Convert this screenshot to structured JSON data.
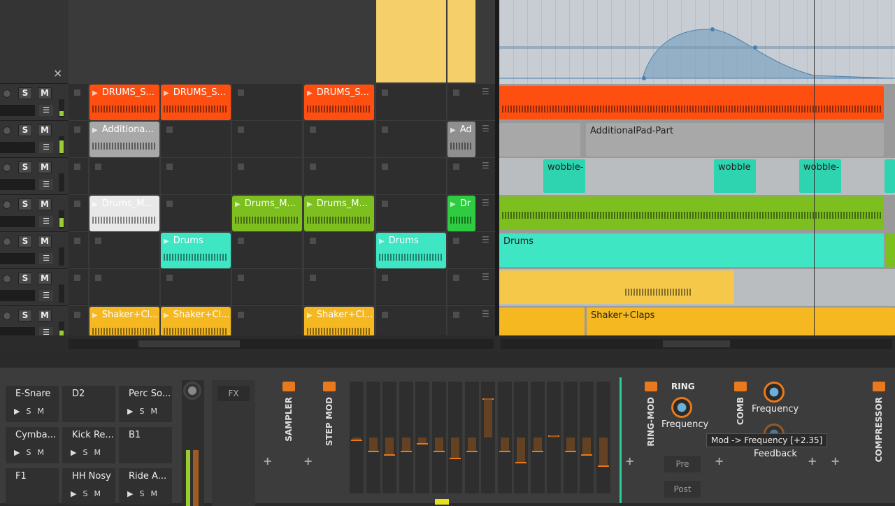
{
  "tracks": [
    {
      "s": "S",
      "m": "M",
      "meter": 0.3
    },
    {
      "s": "S",
      "m": "M",
      "meter": 0.8
    },
    {
      "s": "S",
      "m": "M",
      "meter": 0
    },
    {
      "s": "S",
      "m": "M",
      "meter": 0.6
    },
    {
      "s": "S",
      "m": "M",
      "meter": 0
    },
    {
      "s": "S",
      "m": "M",
      "meter": 0
    },
    {
      "s": "S",
      "m": "M",
      "meter": 0.5
    }
  ],
  "launcher_clips": [
    {
      "label": "DRUMS_S...",
      "color": "#ff4f10"
    },
    {
      "label": "Additiona...",
      "color": "#a8a8a8"
    },
    {
      "label": "Drums_M...",
      "color": "#e8e8e8"
    },
    {
      "label": "Drums",
      "color": "#3ee6c4"
    },
    {
      "label": "Shaker+Cl...",
      "color": "#f5b820"
    },
    {
      "label": "Drums_M...",
      "color": "#7cbf1e"
    },
    {
      "label": "Ad",
      "color": "#8f8f8f"
    },
    {
      "label": "Dr",
      "color": "#2ecc40"
    }
  ],
  "arranger_clips": {
    "additional_pad": "AdditionalPad-Part",
    "wobble": "wobble",
    "wobble_trunc": "wobble-",
    "drums": "Drums",
    "shaker": "Shaker+Claps"
  },
  "drum_pads": [
    {
      "name": "E-Snare",
      "ctl": "▶SM"
    },
    {
      "name": "D2",
      "ctl": ""
    },
    {
      "name": "Perc So...",
      "ctl": "▶SM"
    },
    {
      "name": "Cymba...",
      "ctl": "▶SM"
    },
    {
      "name": "Kick Re...",
      "ctl": "▶SM"
    },
    {
      "name": "B1",
      "ctl": ""
    },
    {
      "name": "F1",
      "ctl": ""
    },
    {
      "name": "HH Nosy",
      "ctl": "▶SM"
    },
    {
      "name": "Ride A...",
      "ctl": "▶SM"
    }
  ],
  "close_x": "×",
  "devices": {
    "fx": "FX",
    "sampler": "SAMPLER",
    "step_mod": "STEP MOD",
    "ring_mod": "RING-MOD",
    "ring": "RING",
    "frequency": "Frequency",
    "comb": "COMB",
    "comb_frequency": "Frequency",
    "feedback": "Feedback",
    "compressor": "COMPRESSOR",
    "pre": "Pre",
    "post": "Post",
    "tooltip": "Mod -> Frequency [+2.35]"
  },
  "step_values": [
    0.48,
    0.38,
    0.35,
    0.38,
    0.45,
    0.38,
    0.32,
    0.38,
    0.85,
    0.38,
    0.28,
    0.38,
    0.52,
    0.38,
    0.35,
    0.25
  ]
}
